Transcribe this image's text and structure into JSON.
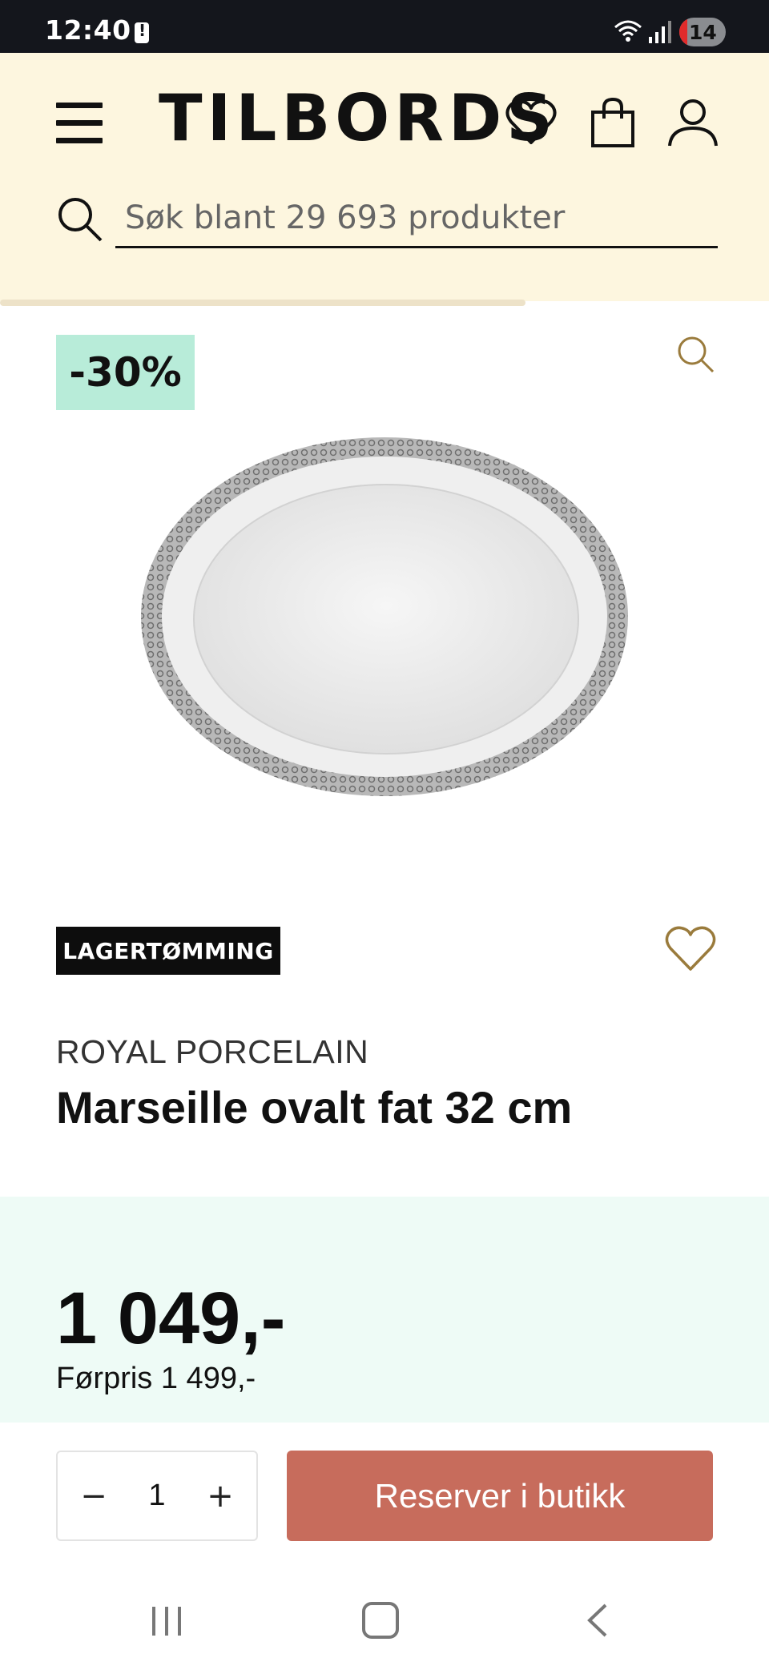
{
  "status_bar": {
    "time": "12:40",
    "battery_level": "14"
  },
  "header": {
    "brand": "TILBORDS",
    "search": {
      "placeholder": "Søk blant 29 693 produkter",
      "value": ""
    }
  },
  "product": {
    "discount": "-30%",
    "tag": "LAGERTØMMING",
    "brand": "ROYAL PORCELAIN",
    "title": "Marseille ovalt fat 32 cm",
    "price": "1 049,-",
    "previous_price": "Førpris 1 499,-"
  },
  "purchase": {
    "quantity": "1",
    "minus_symbol": "−",
    "plus_symbol": "+",
    "reserve_label": "Reserver i butikk"
  },
  "icons": {
    "menu": "hamburger-icon",
    "wishlist": "heart-icon",
    "cart": "shopping-bag-icon",
    "account": "user-icon",
    "search": "search-icon",
    "zoom": "zoom-icon"
  },
  "colors": {
    "header_bg": "#fdf6df",
    "discount_badge": "#b8ecd9",
    "price_band": "#eefbf6",
    "reserve_button": "#c76c5c",
    "icon_gold": "#9a7b3c"
  }
}
